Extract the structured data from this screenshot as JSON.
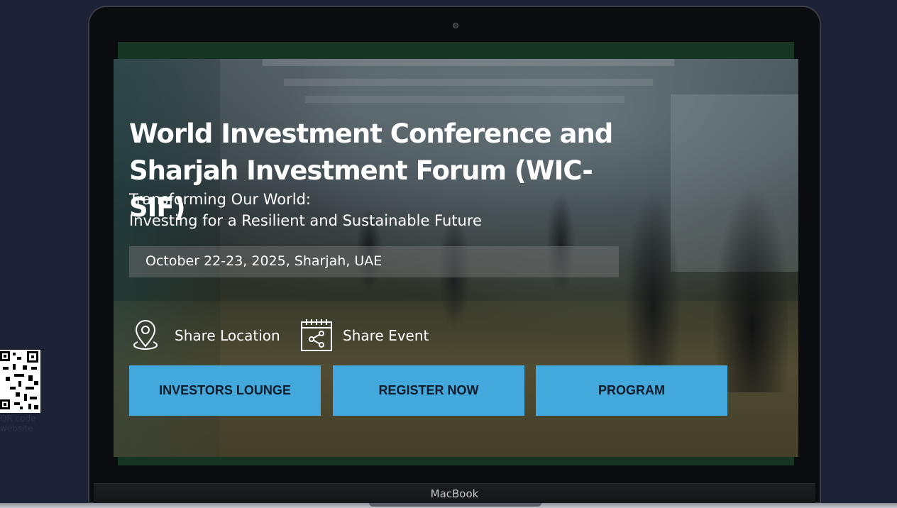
{
  "laptop": {
    "brand": "MacBook"
  },
  "hero": {
    "title_line1": "World Investment Conference and",
    "title_line2": "Sharjah Investment Forum (WIC-SIF)",
    "subtitle_line1": "Transforming Our World:",
    "subtitle_line2": "Investing for a Resilient and Sustainable Future",
    "date": "October 22-23, 2025, Sharjah, UAE"
  },
  "share": {
    "location_label": "Share Location",
    "event_label": "Share Event"
  },
  "buttons": {
    "investors_lounge": "INVESTORS LOUNGE",
    "register_now": "REGISTER NOW",
    "program": "PROGRAM"
  },
  "qr": {
    "caption_line1": "QR code",
    "caption_line2": "website"
  },
  "colors": {
    "page_bg": "#1e2236",
    "button_bg": "#43a9dc",
    "button_text": "#0e1b2a",
    "screen_frame": "#163623"
  },
  "icons": [
    "location-pin-icon",
    "share-calendar-icon",
    "qr-code-icon",
    "camera-icon"
  ]
}
